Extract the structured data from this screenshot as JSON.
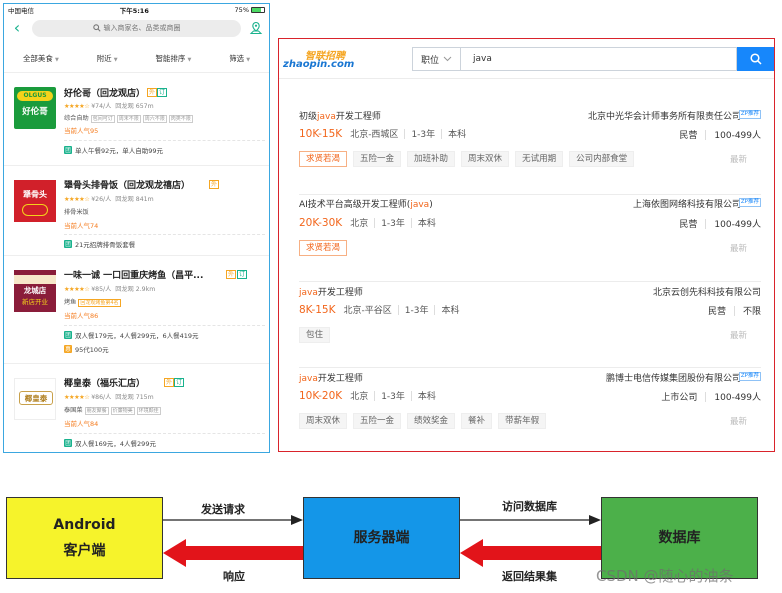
{
  "phone": {
    "status": {
      "carrier": "中国电信",
      "time": "下午5:16",
      "battery": "75%"
    },
    "search_placeholder": "输入商家名、品类或商圈",
    "filters": [
      {
        "label": "全部美食"
      },
      {
        "label": "附近"
      },
      {
        "label": "智能排序"
      },
      {
        "label": "筛选"
      }
    ],
    "shops": [
      {
        "name": "好伦哥（回龙观店）",
        "tag1": "外",
        "tag2": "订",
        "rating": "★★★★☆",
        "price": "¥74/人",
        "area": "回龙观",
        "distance": "657m",
        "category": "综合自助",
        "chips": [
          "包间可订",
          "周末不限",
          "周六不限",
          "肉类不限"
        ],
        "popularity": "当前人气95",
        "deals": [
          {
            "icon": "团",
            "text": "单人午餐92元，单人自助99元"
          }
        ],
        "logo_text": "好伦哥",
        "logo_sub": "OLGUS",
        "logo_color": "#1a9b3c"
      },
      {
        "name": "犟骨头排骨饭（回龙观龙禧店）",
        "tag1": "外",
        "tag2": "",
        "rating": "★★★★☆",
        "price": "¥26/人",
        "area": "回龙观",
        "distance": "841m",
        "category": "排骨米饭",
        "chips": [],
        "popularity": "当前人气74",
        "deals": [
          {
            "icon": "团",
            "text": "21元招牌排骨饭套餐"
          }
        ],
        "logo_text": "犟骨头",
        "logo_sub": "",
        "logo_color": "#d1202a"
      },
      {
        "name": "一味一诚 一口回重庆烤鱼（昌平...",
        "tag1": "外",
        "tag2": "订",
        "rating": "★★★★☆",
        "price": "¥85/人",
        "area": "回龙观",
        "distance": "2.9km",
        "category": "烤鱼",
        "chips": [
          "回龙观烤鱼第4名"
        ],
        "popularity": "当前人气86",
        "deals": [
          {
            "icon": "团",
            "text": "双人餐179元，4人餐299元，6人餐419元"
          },
          {
            "icon": "惠",
            "text": "95代100元"
          }
        ],
        "logo_text": "龙城店",
        "logo_sub": "新店开业",
        "logo_color": "#8a1d3a"
      },
      {
        "name": "椰皇泰（福乐汇店）",
        "tag1": "外",
        "tag2": "订",
        "rating": "★★★★☆",
        "price": "¥86/人",
        "area": "回龙观",
        "distance": "715m",
        "category": "泰国菜",
        "chips": [
          "朋友聚餐",
          "价廉物美",
          "环境颇佳"
        ],
        "popularity": "当前人气84",
        "deals": [
          {
            "icon": "团",
            "text": "双人餐169元，4人餐299元"
          }
        ],
        "logo_text": "椰皇泰",
        "logo_sub": "",
        "logo_color": "#c8a04a"
      }
    ]
  },
  "jobs_panel": {
    "logo_text": "智联招聘",
    "logo_sub": "zhaopin.com",
    "search_category": "职位",
    "search_value": "java",
    "listings": [
      {
        "title_pre": "初级",
        "title_hl": "java",
        "title_post": "开发工程师",
        "company": "北京中光华会计师事务所有限责任公司",
        "badge": "ZP推荐",
        "salary": "10K-15K",
        "location": "北京-西城区",
        "experience": "1-3年",
        "education": "本科",
        "company_type": "民营",
        "company_size": "100-499人",
        "tags": [
          "求贤若渴",
          "五险一金",
          "加班补助",
          "周末双休",
          "无试用期",
          "公司内部食堂"
        ],
        "tag_hl": [
          true,
          false,
          false,
          false,
          false,
          false
        ],
        "fresh": "最新"
      },
      {
        "title_pre": "AI技术平台高级开发工程师(",
        "title_hl": "java",
        "title_post": ")",
        "company": "上海依图网络科技有限公司",
        "badge": "ZP推荐",
        "salary": "20K-30K",
        "location": "北京",
        "experience": "1-3年",
        "education": "本科",
        "company_type": "民营",
        "company_size": "100-499人",
        "tags": [
          "求贤若渴"
        ],
        "tag_hl": [
          true
        ],
        "fresh": "最新"
      },
      {
        "title_pre": "",
        "title_hl": "java",
        "title_post": "开发工程师",
        "company": "北京云创先科科技有限公司",
        "badge": "",
        "salary": "8K-15K",
        "location": "北京-平谷区",
        "experience": "1-3年",
        "education": "本科",
        "company_type": "民营",
        "company_size": "不限",
        "tags": [
          "包住"
        ],
        "tag_hl": [
          false
        ],
        "fresh": "最新"
      },
      {
        "title_pre": "",
        "title_hl": "java",
        "title_post": "开发工程师",
        "company": "鹏博士电信传媒集团股份有限公司",
        "badge": "ZP推荐",
        "salary": "10K-20K",
        "location": "北京",
        "experience": "1-3年",
        "education": "本科",
        "company_type": "上市公司",
        "company_size": "100-499人",
        "tags": [
          "周末双休",
          "五险一金",
          "绩效奖金",
          "餐补",
          "带薪年假"
        ],
        "tag_hl": [
          false,
          false,
          false,
          false,
          false
        ],
        "fresh": "最新"
      }
    ]
  },
  "diagram": {
    "android_line1": "Android",
    "android_line2": "客户端",
    "server": "服务器端",
    "database": "数据库",
    "send_request": "发送请求",
    "response": "响应",
    "access_db": "访问数据库",
    "return_result": "返回结果集",
    "colors": {
      "android": "#f6f32b",
      "server": "#1496e8",
      "database": "#4cb04a",
      "arrow": "#e2141a"
    }
  },
  "watermark": "CSDN @随心的油条"
}
